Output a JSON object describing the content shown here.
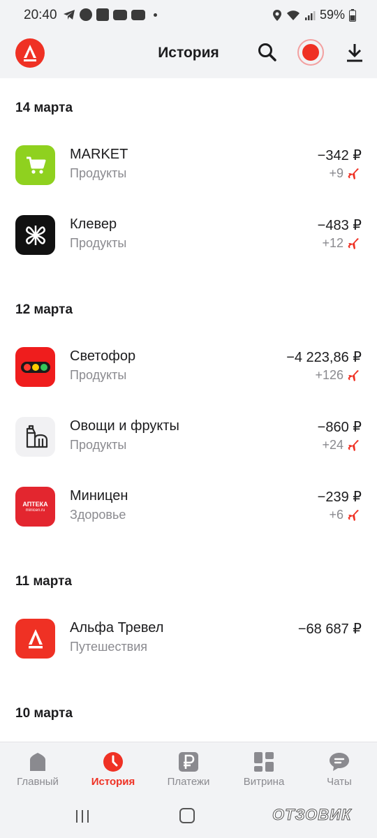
{
  "status_bar": {
    "time": "20:40",
    "battery": "59%"
  },
  "header": {
    "title": "История"
  },
  "sections": [
    {
      "date": "14 марта",
      "transactions": [
        {
          "name": "MARKET",
          "category": "Продукты",
          "amount": "−342 ₽",
          "bonus": "+9"
        },
        {
          "name": "Клевер",
          "category": "Продукты",
          "amount": "−483 ₽",
          "bonus": "+12"
        }
      ]
    },
    {
      "date": "12 марта",
      "transactions": [
        {
          "name": "Светофор",
          "category": "Продукты",
          "amount": "−4 223,86 ₽",
          "bonus": "+126"
        },
        {
          "name": "Овощи и фрукты",
          "category": "Продукты",
          "amount": "−860 ₽",
          "bonus": "+24"
        },
        {
          "name": "Миницен",
          "category": "Здоровье",
          "amount": "−239 ₽",
          "bonus": "+6"
        }
      ]
    },
    {
      "date": "11 марта",
      "transactions": [
        {
          "name": "Альфа Тревел",
          "category": "Путешествия",
          "amount": "−68 687 ₽",
          "bonus": ""
        }
      ]
    },
    {
      "date": "10 марта",
      "transactions": []
    }
  ],
  "mini_logo_text": {
    "line1": "АПТЕКА",
    "line2": "minicen.ru"
  },
  "bottom_nav": [
    {
      "label": "Главный",
      "icon": "home-icon"
    },
    {
      "label": "История",
      "icon": "clock-icon"
    },
    {
      "label": "Платежи",
      "icon": "ruble-icon"
    },
    {
      "label": "Витрина",
      "icon": "showcase-icon"
    },
    {
      "label": "Чаты",
      "icon": "chat-icon"
    }
  ],
  "watermark": "ОТЗОВИК",
  "colors": {
    "accent": "#ef3124",
    "market_green": "#8fd11f",
    "klever_black": "#111111"
  }
}
